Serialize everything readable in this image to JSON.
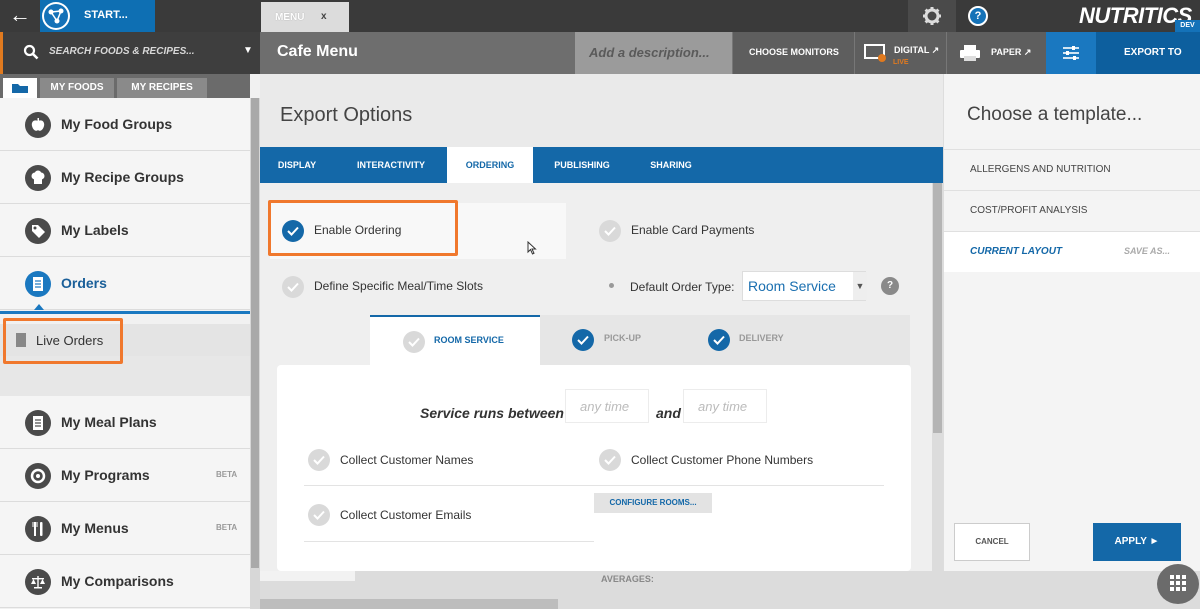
{
  "topbar": {
    "start_label": "START...",
    "tab_label": "MENU",
    "tab_close": "x",
    "help_glyph": "?",
    "brand": "NUTRITICS",
    "brand_env": "DEV"
  },
  "subbar": {
    "search_label": "SEARCH FOODS & RECIPES...",
    "page_title": "Cafe Menu",
    "description_placeholder": "Add a description...",
    "choose_monitors": "CHOOSE MONITORS",
    "digital": "DIGITAL ↗",
    "digital_status": "LIVE",
    "paper": "PAPER ↗",
    "export_to": "EXPORT TO"
  },
  "sidebar": {
    "tabs": [
      "MY FOODS",
      "MY RECIPES"
    ],
    "items": [
      {
        "label": "My Food Groups",
        "icon": "apple-icon",
        "beta": ""
      },
      {
        "label": "My Recipe Groups",
        "icon": "chef-hat-icon",
        "beta": ""
      },
      {
        "label": "My Labels",
        "icon": "tag-icon",
        "beta": ""
      },
      {
        "label": "Orders",
        "icon": "document-icon",
        "beta": ""
      },
      {
        "label": "My Meal Plans",
        "icon": "document-icon",
        "beta": ""
      },
      {
        "label": "My Programs",
        "icon": "program-icon",
        "beta": "BETA"
      },
      {
        "label": "My Menus",
        "icon": "cutlery-icon",
        "beta": "BETA"
      },
      {
        "label": "My Comparisons",
        "icon": "scales-icon",
        "beta": ""
      }
    ],
    "sub_item": "Live Orders"
  },
  "export": {
    "title": "Export Options",
    "tabs": [
      "DISPLAY",
      "INTERACTIVITY",
      "ORDERING",
      "PUBLISHING",
      "SHARING"
    ],
    "active_tab": "ORDERING",
    "enable_ordering": "Enable Ordering",
    "enable_card_payments": "Enable Card Payments",
    "define_slots": "Define Specific Meal/Time Slots",
    "default_order_type_label": "Default Order Type:",
    "default_order_type_value": "Room Service",
    "help_glyph": "?",
    "subtabs": [
      "ROOM SERVICE",
      "PICK-UP",
      "DELIVERY"
    ],
    "service_runs": "Service runs between",
    "time_placeholder": "any time",
    "and_label": "and",
    "collect_names": "Collect Customer Names",
    "collect_phones": "Collect Customer Phone Numbers",
    "collect_emails": "Collect Customer Emails",
    "configure_rooms": "CONFIGURE ROOMS..."
  },
  "templates": {
    "title": "Choose a template...",
    "items": [
      "ALLERGENS AND NUTRITION",
      "COST/PROFIT ANALYSIS",
      "CURRENT LAYOUT"
    ],
    "save_as": "SAVE AS...",
    "cancel": "CANCEL",
    "apply": "APPLY ►"
  },
  "bottom": {
    "averages": "AVERAGES:"
  },
  "colors": {
    "accent": "#1468a8",
    "highlight": "#f0782d",
    "live": "#e07a1f"
  }
}
